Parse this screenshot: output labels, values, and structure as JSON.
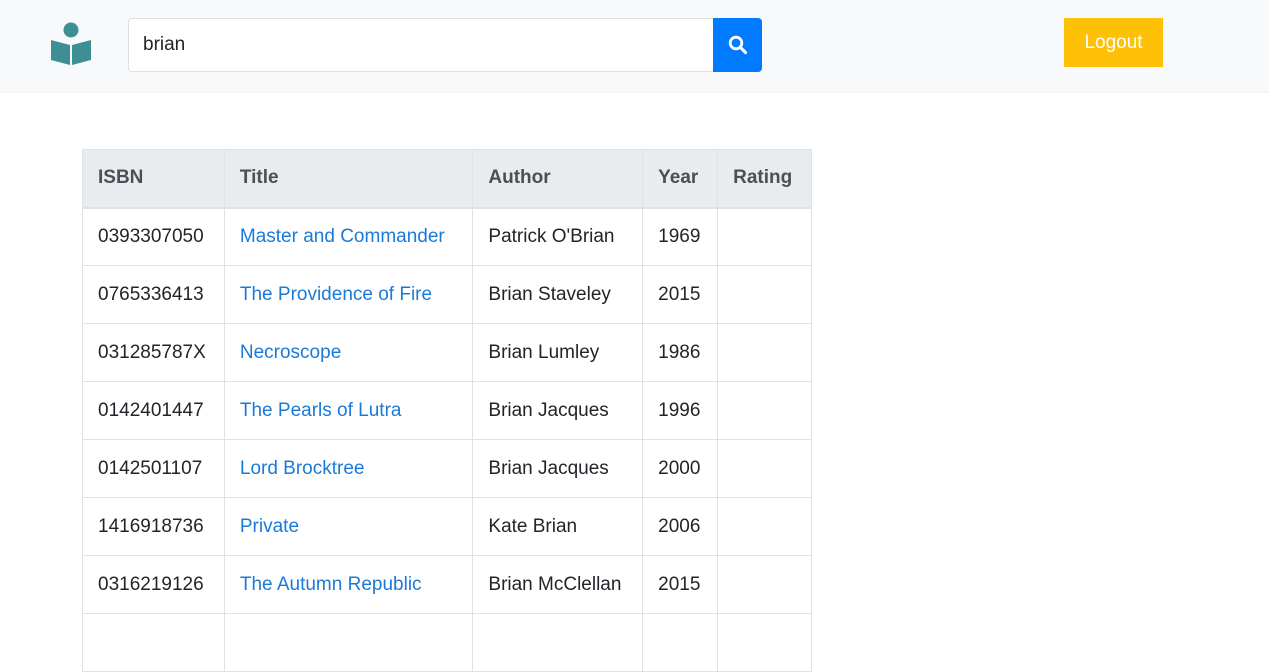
{
  "header": {
    "logo_icon": "reader-book-icon",
    "search_value": "brian",
    "search_icon": "search-icon",
    "logout_label": "Logout"
  },
  "colors": {
    "accent": "#007bff",
    "logout": "#ffc107",
    "logo": "#3d8f93",
    "link": "#1a7ad9"
  },
  "table": {
    "headers": [
      "ISBN",
      "Title",
      "Author",
      "Year",
      "Rating"
    ],
    "rows": [
      {
        "isbn": "0393307050",
        "title": "Master and Commander",
        "author": "Patrick O'Brian",
        "year": "1969",
        "rating": ""
      },
      {
        "isbn": "0765336413",
        "title": "The Providence of Fire",
        "author": "Brian Staveley",
        "year": "2015",
        "rating": ""
      },
      {
        "isbn": "031285787X",
        "title": "Necroscope",
        "author": "Brian Lumley",
        "year": "1986",
        "rating": ""
      },
      {
        "isbn": "0142401447",
        "title": "The Pearls of Lutra",
        "author": "Brian Jacques",
        "year": "1996",
        "rating": ""
      },
      {
        "isbn": "0142501107",
        "title": "Lord Brocktree",
        "author": "Brian Jacques",
        "year": "2000",
        "rating": ""
      },
      {
        "isbn": "1416918736",
        "title": "Private",
        "author": "Kate Brian",
        "year": "2006",
        "rating": ""
      },
      {
        "isbn": "0316219126",
        "title": "The Autumn Republic",
        "author": "Brian McClellan",
        "year": "2015",
        "rating": ""
      },
      {
        "isbn": "",
        "title": "",
        "author": "",
        "year": "",
        "rating": ""
      }
    ]
  }
}
